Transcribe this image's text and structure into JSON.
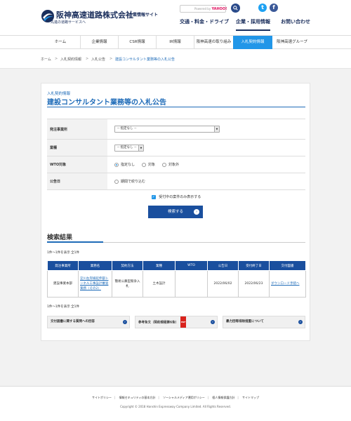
{
  "header": {
    "logo_title": "阪神高速道路株式会社",
    "logo_sub": "企業情報サイト",
    "logo_tagline": "先進の道路サービスへ",
    "search_powered": "Powered by",
    "search_brand": "YAHOO!",
    "nav": [
      "交通・料金・ドライブ",
      "企業・採用情報",
      "お問い合わせ"
    ],
    "active_nav": 1,
    "colors": {
      "brand": "#1a2e5c",
      "accent": "#2196e8",
      "twitter": "#1da1f2",
      "facebook": "#3b5998"
    }
  },
  "gmenu": [
    "ホーム",
    "企業情報",
    "CSR情報",
    "IR情報",
    "阪神高速の取り組み",
    "入札契約情報",
    "阪神高速グループ"
  ],
  "breadcrumb": [
    "ホーム",
    "入札契約情報",
    "入札公告",
    "建設コンサルタント業務等の入札公告"
  ],
  "page": {
    "eyebrow": "入札契約情報",
    "title": "建設コンサルタント業務等の入札公告"
  },
  "form": {
    "office_label": "発注事業所",
    "office_value": "-- 指定なし --",
    "category_label": "業種",
    "category_value": "-- 指定なし --",
    "wto_label": "WTO対象",
    "wto_options": [
      "指定なし",
      "対象",
      "対象外"
    ],
    "date_label": "公告日",
    "date_option": "期間で絞り込む",
    "accepting_only": "受付中の案件のみ表示する",
    "search_button": "検索する"
  },
  "results": {
    "title": "検索結果",
    "count": "1件～1件を表示 全1件",
    "headers": [
      "発注事業所",
      "業務名",
      "契約方法",
      "業種",
      "WTO",
      "公告日",
      "受付終了日",
      "交付図書"
    ],
    "rows": [
      {
        "office": "建設事業本部",
        "name": "淀川左岸線延伸部トンネル工事設計審査業務（その2）",
        "method": "簡易公募型競争入札",
        "category": "土木設計",
        "wto": "",
        "announced": "2022/06/02",
        "deadline": "2022/06/23",
        "docs": "ダウンロード手続へ"
      }
    ]
  },
  "link_buttons": [
    "交付図書に関する質問への回答",
    "参考条文（契約規程第6条）",
    "暴力団等排除措置について"
  ],
  "pdf_badge": "PDF",
  "footer": {
    "links": [
      "サイトポリシー",
      "情報セキュリティの基本方針",
      "ソーシャルメディア運用ポリシー",
      "個人情報保護方針",
      "サイトマップ"
    ],
    "copyright": "Copyright © 2018 Hanshin Expressway Company Limited. All Rights Reserved."
  }
}
